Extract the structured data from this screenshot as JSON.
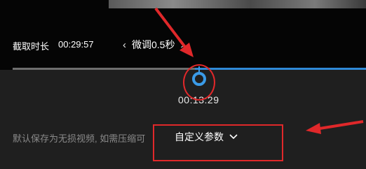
{
  "colors": {
    "accent": "#3a9be8",
    "annotation_red": "#e0282a",
    "background": "#1f1f1f",
    "top_band": "#050505"
  },
  "capture": {
    "label": "截取时长",
    "value": "00:29:57"
  },
  "fine_tune": {
    "prev_icon": "chevron-left-icon",
    "label": "微调0.5秒",
    "next_icon": "chevron-right-icon"
  },
  "timeline": {
    "current_time": "00:13:29"
  },
  "export": {
    "hint": "默认保存为无损视频, 如需压缩可",
    "custom_label": "自定义参数",
    "dropdown_icon": "chevron-down-icon"
  }
}
